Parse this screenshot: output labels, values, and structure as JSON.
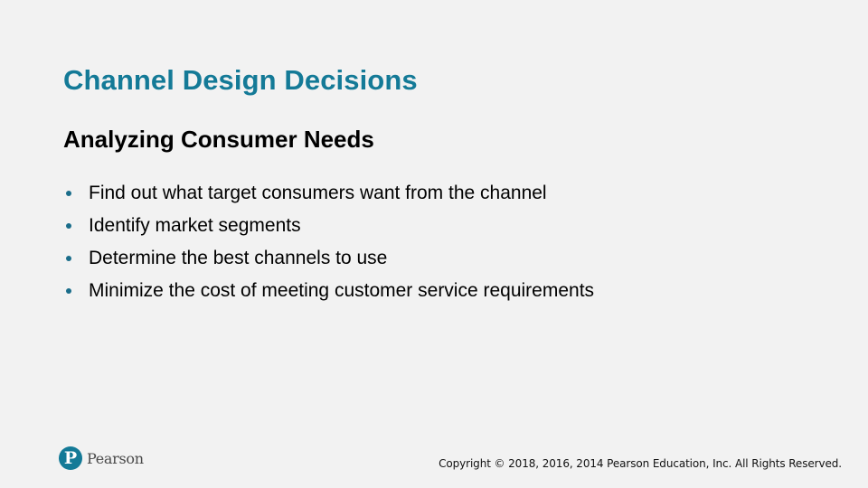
{
  "slide": {
    "title": "Channel Design Decisions",
    "subtitle": "Analyzing Consumer Needs",
    "bullets": [
      "Find out what target consumers want from the channel",
      "Identify market segments",
      "Determine the best channels to use",
      "Minimize the cost of meeting customer service requirements"
    ]
  },
  "footer": {
    "logo_glyph": "P",
    "logo_text": "Pearson",
    "copyright": "Copyright © 2018, 2016, 2014 Pearson Education, Inc. All Rights Reserved."
  },
  "colors": {
    "title": "#147a97",
    "background": "#f2f2f2",
    "bullet": "#1a6d8a"
  }
}
